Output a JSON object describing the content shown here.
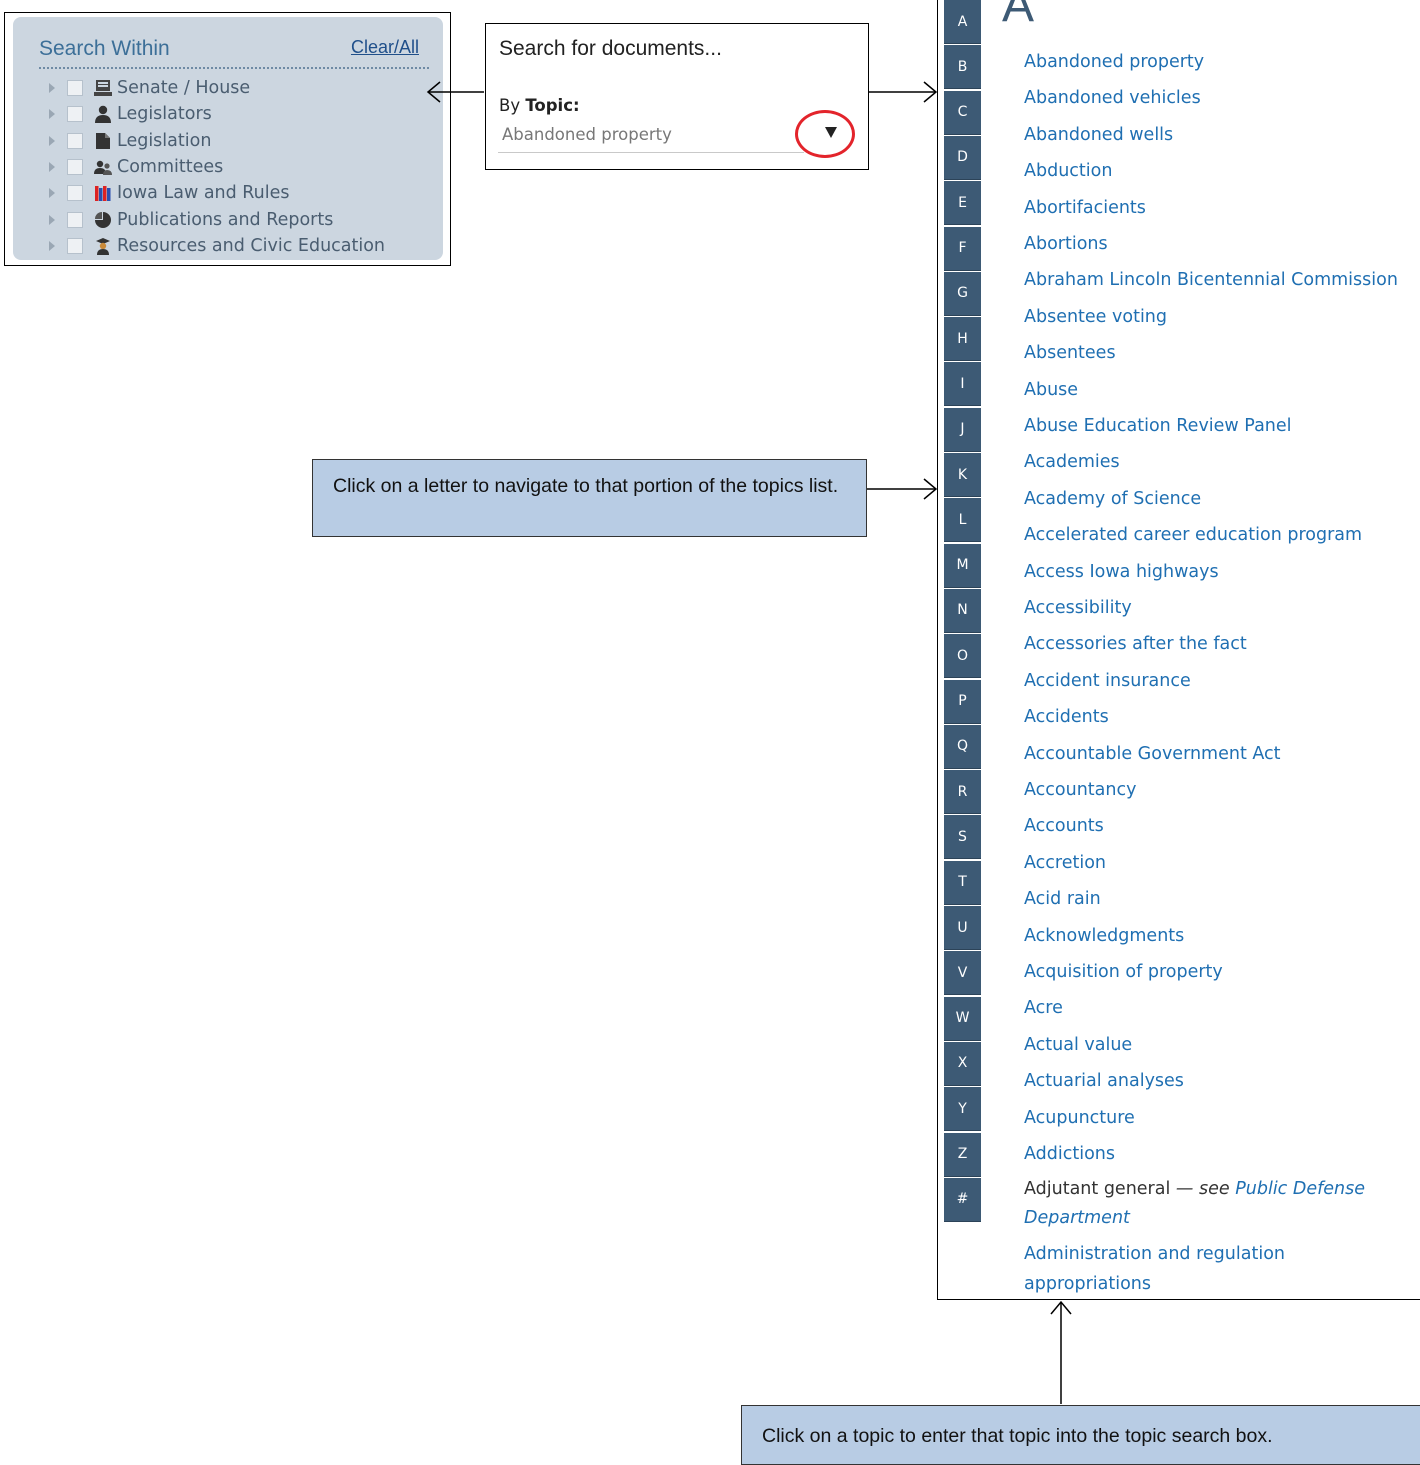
{
  "search_within": {
    "title": "Search Within",
    "clear_all": "Clear/All",
    "items": [
      {
        "label": "Senate / House",
        "icon": "senate-house-icon"
      },
      {
        "label": "Legislators",
        "icon": "person-icon"
      },
      {
        "label": "Legislation",
        "icon": "document-icon"
      },
      {
        "label": "Committees",
        "icon": "group-icon"
      },
      {
        "label": "Iowa Law and Rules",
        "icon": "books-icon"
      },
      {
        "label": "Publications and Reports",
        "icon": "pie-chart-icon"
      },
      {
        "label": "Resources and Civic Education",
        "icon": "graduate-icon"
      }
    ]
  },
  "search_docs": {
    "title": "Search for documents...",
    "by_label": "By ",
    "topic_label": "Topic:",
    "topic_value": "Abandoned property"
  },
  "topics": {
    "current_letter": "A",
    "letters": [
      "A",
      "B",
      "C",
      "D",
      "E",
      "F",
      "G",
      "H",
      "I",
      "J",
      "K",
      "L",
      "M",
      "N",
      "O",
      "P",
      "Q",
      "R",
      "S",
      "T",
      "U",
      "V",
      "W",
      "X",
      "Y",
      "Z",
      "#"
    ],
    "items": [
      "Abandoned property",
      "Abandoned vehicles",
      "Abandoned wells",
      "Abduction",
      "Abortifacients",
      "Abortions",
      "Abraham Lincoln Bicentennial Commission",
      "Absentee voting",
      "Absentees",
      "Abuse",
      "Abuse Education Review Panel",
      "Academies",
      "Academy of Science",
      "Accelerated career education program",
      "Access Iowa highways",
      "Accessibility",
      "Accessories after the fact",
      "Accident insurance",
      "Accidents",
      "Accountable Government Act",
      "Accountancy",
      "Accounts",
      "Accretion",
      "Acid rain",
      "Acknowledgments",
      "Acquisition of property",
      "Acre",
      "Actual value",
      "Actuarial analyses",
      "Acupuncture",
      "Addictions"
    ],
    "see_item": {
      "term": "Adjutant general",
      "see_text": "— see ",
      "target_line1": "Public Defense",
      "target_line2": "Department"
    },
    "last_item": {
      "line1": "Administration and regulation",
      "line2": "appropriations"
    }
  },
  "callouts": {
    "letter_nav": "Click on a letter to navigate to that portion of the topics list.",
    "topic_click": "Click on a topic to enter that topic into the topic search box."
  }
}
